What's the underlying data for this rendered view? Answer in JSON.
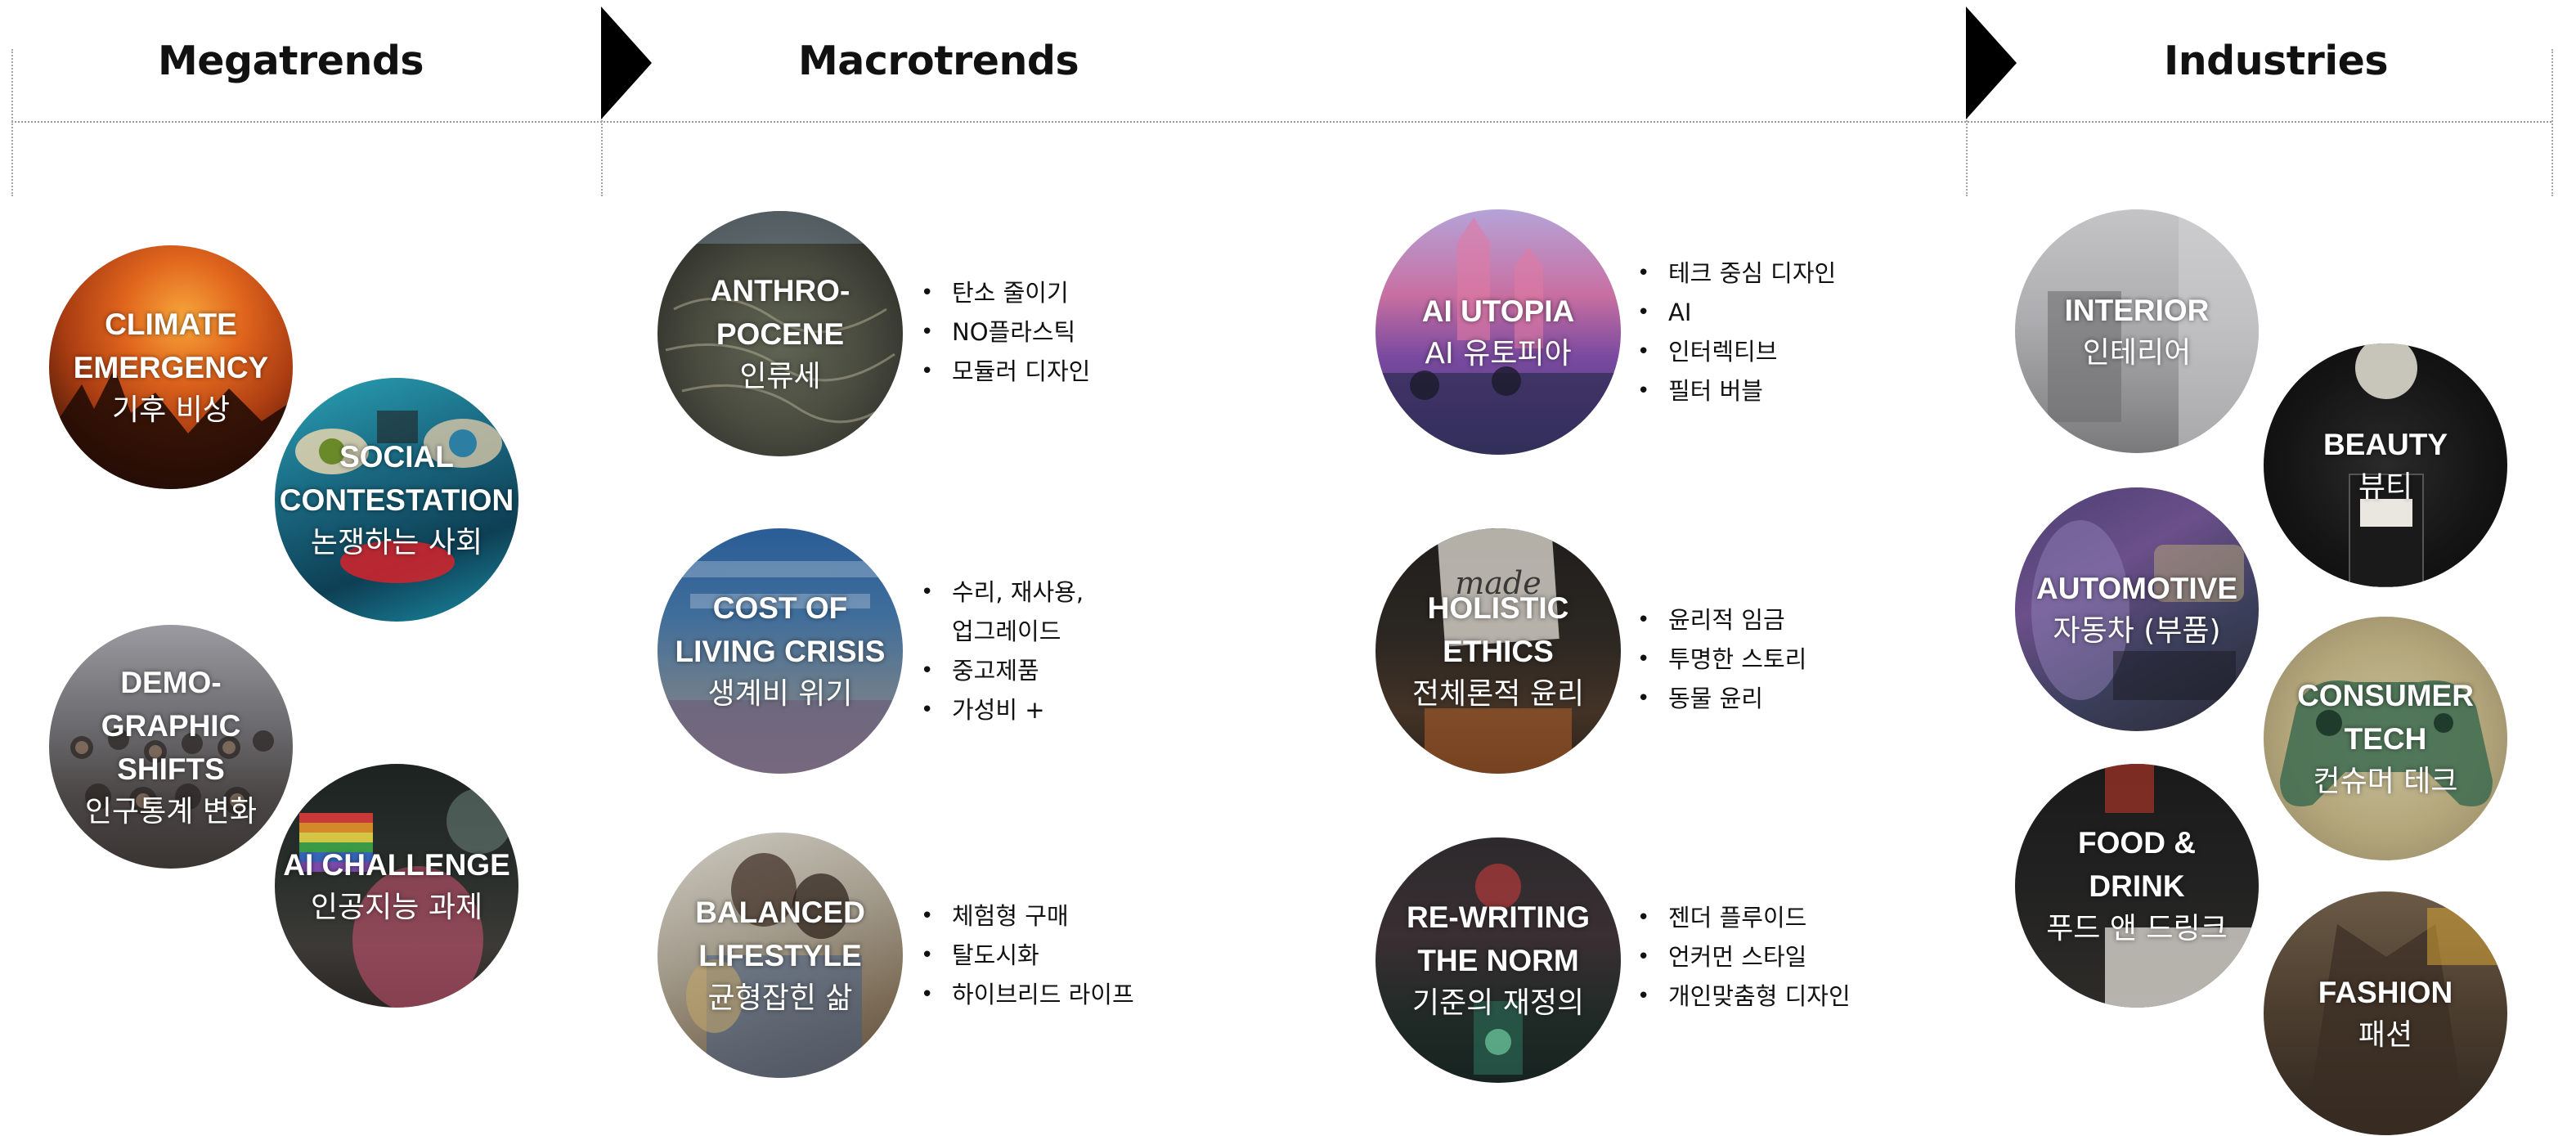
{
  "headers": {
    "megatrends": "Megatrends",
    "macrotrends": "Macrotrends",
    "industries": "Industries"
  },
  "megatrends": [
    {
      "title": "CLIMATE\nEMERGENCY",
      "korean": "기후 비상",
      "icon": "sunset-forest-photo"
    },
    {
      "title": "SOCIAL\nCONTESTATION",
      "korean": "논쟁하는 사회",
      "icon": "eyes-collage-photo"
    },
    {
      "title": "DEMO-\nGRAPHIC\nSHIFTS",
      "korean": "인구통계 변화",
      "icon": "crowd-photo"
    },
    {
      "title": "AI CHALLENGE",
      "korean": "인공지능 과제",
      "icon": "rainbow-flag-photo"
    }
  ],
  "macrotrends": [
    {
      "title": "ANTHRO-\nPOCENE",
      "korean": "인류세",
      "icon": "landfill-photo",
      "bullets": [
        "탄소 줄이기",
        "NO플라스틱",
        "모듈러 디자인"
      ]
    },
    {
      "title": "COST OF\nLIVING CRISIS",
      "korean": "생계비 위기",
      "icon": "graffiti-wall-photo",
      "bullets": [
        "수리, 재사용,\n업그레이드",
        "중고제품",
        "가성비 +"
      ]
    },
    {
      "title": "BALANCED\nLIFESTYLE",
      "korean": "균형잡힌 삶",
      "icon": "couple-photo",
      "bullets": [
        "체험형 구매",
        "탈도시화",
        "하이브리드 라이프"
      ]
    },
    {
      "title": "AI UTOPIA",
      "korean": "AI 유토피아",
      "icon": "fantasy-city-photo",
      "bullets": [
        "테크 중심 디자인",
        "AI",
        "인터렉티브",
        "필터 버블"
      ]
    },
    {
      "title": "HOLISTIC\nETHICS",
      "korean": "전체론적 윤리",
      "icon": "protest-sign-photo",
      "bullets": [
        "윤리적 임금",
        "투명한 스토리",
        "동물 윤리"
      ]
    },
    {
      "title": "RE-WRITING\nTHE NORM",
      "korean": "기준의 재정의",
      "icon": "neon-street-photo",
      "bullets": [
        "젠더 플루이드",
        "언커먼 스타일",
        "개인맞춤형 디자인"
      ]
    }
  ],
  "industries": [
    {
      "title": "INTERIOR",
      "korean": "인테리어",
      "icon": "interior-photo"
    },
    {
      "title": "BEAUTY",
      "korean": "뷰티",
      "icon": "perfume-bottle-photo"
    },
    {
      "title": "AUTOMOTIVE",
      "korean": "자동차 (부품)",
      "icon": "car-interior-photo"
    },
    {
      "title": "CONSUMER\nTECH",
      "korean": "컨슈머 테크",
      "icon": "game-controller-photo"
    },
    {
      "title": "FOOD &\nDRINK",
      "korean": "푸드 앤 드링크",
      "icon": "food-package-photo"
    },
    {
      "title": "FASHION",
      "korean": "패션",
      "icon": "coat-photo"
    }
  ]
}
